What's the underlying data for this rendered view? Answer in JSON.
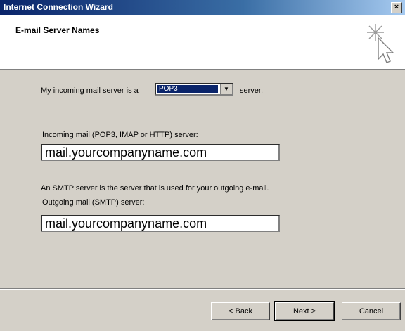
{
  "window": {
    "title": "Internet Connection Wizard",
    "close_glyph": "×"
  },
  "header": {
    "title": "E-mail Server Names",
    "icon": "wizard-sparkle-cursor-icon"
  },
  "incoming_type": {
    "prefix": "My incoming mail server is a",
    "selected": "POP3",
    "suffix": "server."
  },
  "incoming_server": {
    "label": "Incoming mail (POP3, IMAP or HTTP) server:",
    "value": "mail.yourcompanyname.com"
  },
  "smtp_note": "An SMTP server is the server that is used for your outgoing e-mail.",
  "outgoing_server": {
    "label": "Outgoing mail (SMTP) server:",
    "value": "mail.yourcompanyname.com"
  },
  "buttons": {
    "back": "< Back",
    "next": "Next >",
    "cancel": "Cancel"
  }
}
